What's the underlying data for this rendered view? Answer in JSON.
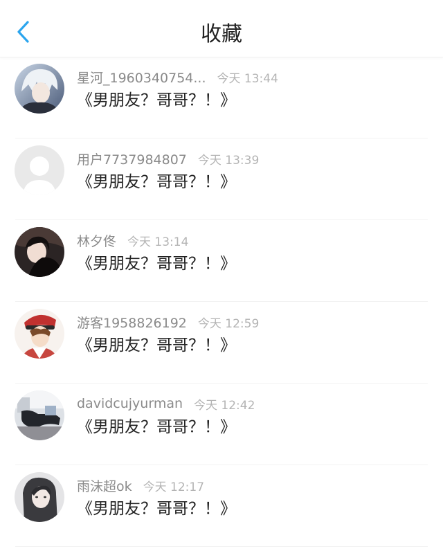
{
  "header": {
    "title": "收藏",
    "back_icon": "chevron-left-icon",
    "accent_color": "#2ba5ee"
  },
  "items": [
    {
      "username": "星河_1960340754...",
      "time": "今天 13:44",
      "content": "《男朋友？哥哥？！》",
      "avatar": "avatar-anime-white-hair"
    },
    {
      "username": "用户7737984807",
      "time": "今天 13:39",
      "content": "《男朋友？哥哥？！》",
      "avatar": "avatar-default-placeholder"
    },
    {
      "username": "林夕佟",
      "time": "今天 13:14",
      "content": "《男朋友？哥哥？！》",
      "avatar": "avatar-girl-photo"
    },
    {
      "username": "游客1958826192",
      "time": "今天 12:59",
      "content": "《男朋友？哥哥？！》",
      "avatar": "avatar-anime-red-cap"
    },
    {
      "username": "davidcujyurman",
      "time": "今天 12:42",
      "content": "《男朋友？哥哥？！》",
      "avatar": "avatar-room-photo"
    },
    {
      "username": "雨沫超ok",
      "time": "今天 12:17",
      "content": "《男朋友？哥哥？！》",
      "avatar": "avatar-girl-long-hair"
    }
  ]
}
